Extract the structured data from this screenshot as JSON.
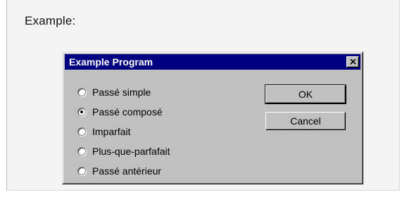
{
  "page": {
    "heading": "Example:"
  },
  "dialog": {
    "title": "Example Program",
    "close_label": "×",
    "options": [
      {
        "label": "Passé simple",
        "checked": false
      },
      {
        "label": "Passé composé",
        "checked": true
      },
      {
        "label": "Imparfait",
        "checked": false
      },
      {
        "label": "Plus-que-parfafait",
        "checked": false
      },
      {
        "label": "Passé antérieur",
        "checked": false
      }
    ],
    "ok_label": "OK",
    "cancel_label": "Cancel"
  },
  "colors": {
    "titlebar": "#000080",
    "dialog_face": "#c0c0c0",
    "frame_bg": "#f4f4f4"
  }
}
